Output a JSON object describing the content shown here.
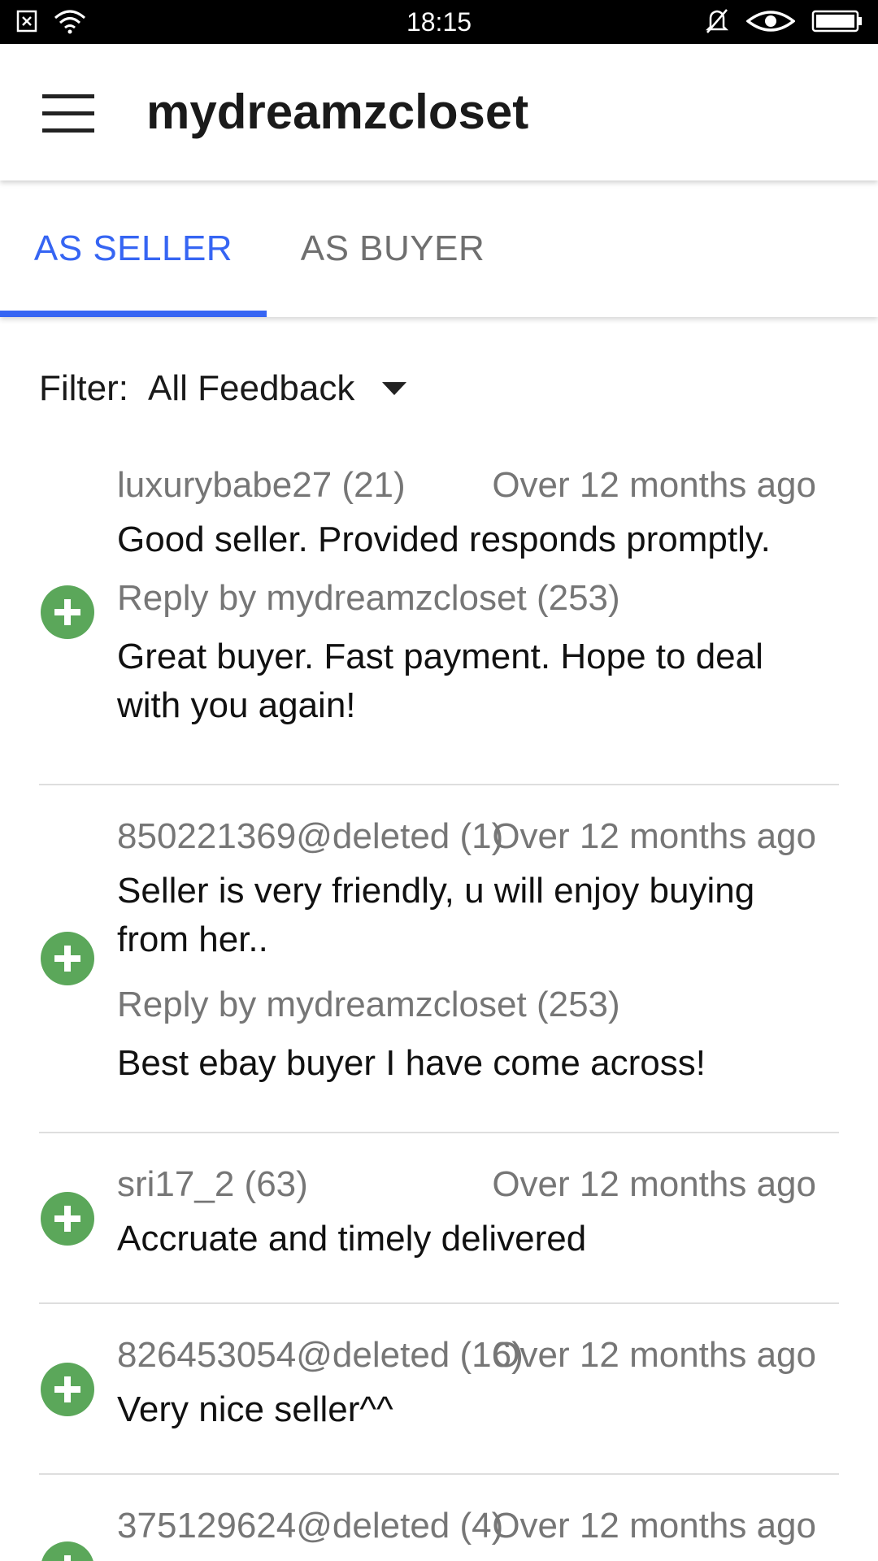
{
  "status_bar": {
    "time": "18:15",
    "icons": [
      "notification-x-icon",
      "wifi-icon",
      "bell-off-icon",
      "eye-icon",
      "battery-icon"
    ]
  },
  "app_bar": {
    "title": "mydreamzcloset",
    "menu_icon": "hamburger-menu-icon"
  },
  "tabs": [
    {
      "label": "AS SELLER",
      "selected": true
    },
    {
      "label": "AS BUYER",
      "selected": false
    }
  ],
  "filter": {
    "label": "Filter:",
    "value": "All Feedback"
  },
  "feedback": [
    {
      "user": "luxurybabe27 (21)",
      "time": "Over 12 months ago",
      "comment": "Good seller. Provided responds promptly.",
      "reply_by": "Reply by mydreamzcloset (253)",
      "reply": "Great buyer. Fast payment. Hope to deal with you again!",
      "rating": "positive"
    },
    {
      "user": "850221369@deleted (1)",
      "time": "Over 12 months ago",
      "comment": "Seller is very friendly, u will enjoy buying from her..",
      "reply_by": "Reply by mydreamzcloset (253)",
      "reply": "Best ebay buyer I have come across!",
      "rating": "positive"
    },
    {
      "user": "sri17_2 (63)",
      "time": "Over 12 months ago",
      "comment": "Accruate and timely delivered",
      "rating": "positive"
    },
    {
      "user": "826453054@deleted (16)",
      "time": "Over 12 months ago",
      "comment": "Very nice seller^^",
      "rating": "positive"
    },
    {
      "user": "375129624@deleted (4)",
      "time": "Over 12 months ago",
      "rating": "positive"
    }
  ],
  "colors": {
    "accent": "#3665f3",
    "positive": "#5ba75a",
    "muted_text": "#767676",
    "divider": "#dedede"
  }
}
